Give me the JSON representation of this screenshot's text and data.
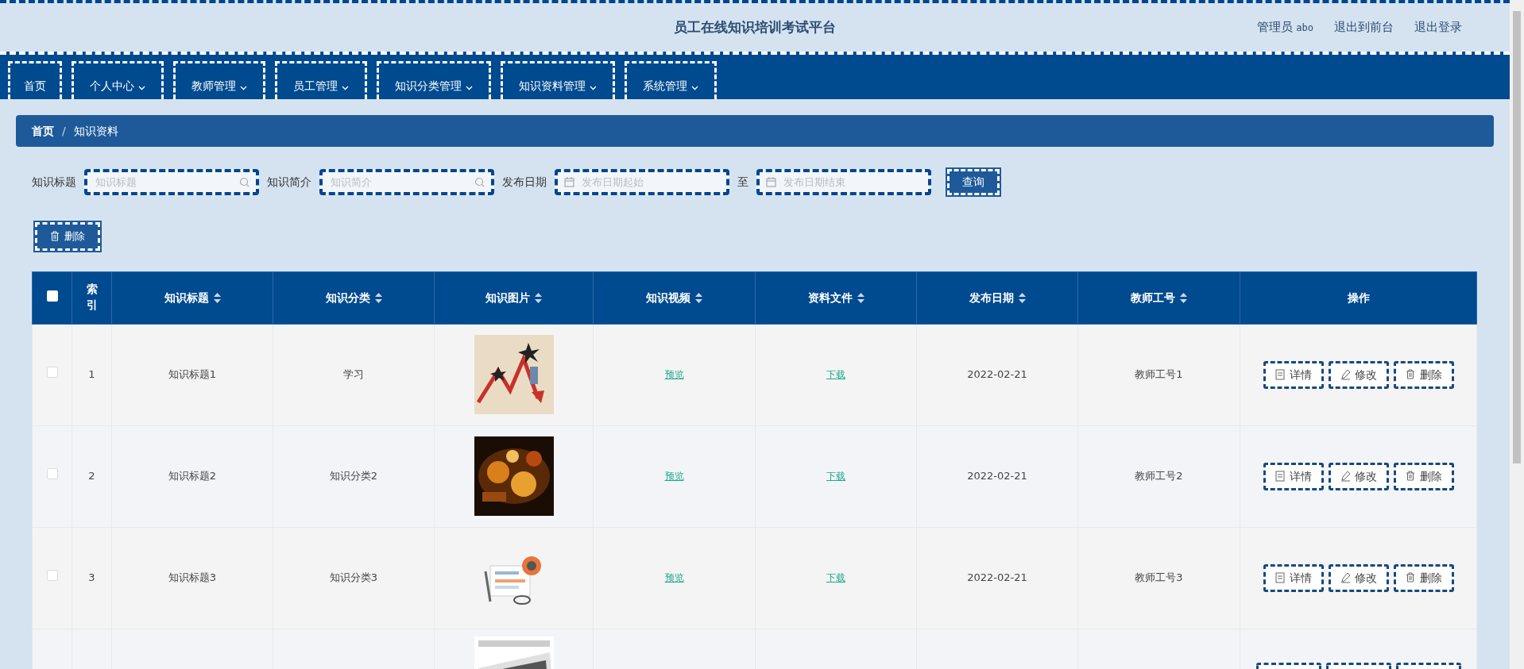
{
  "header": {
    "title": "员工在线知识培训考试平台",
    "user_role": "管理员",
    "user_name": "abo",
    "links": [
      "退出到前台",
      "退出登录"
    ]
  },
  "nav": [
    {
      "label": "首页",
      "dropdown": false
    },
    {
      "label": "个人中心",
      "dropdown": true
    },
    {
      "label": "教师管理",
      "dropdown": true
    },
    {
      "label": "员工管理",
      "dropdown": true
    },
    {
      "label": "知识分类管理",
      "dropdown": true
    },
    {
      "label": "知识资料管理",
      "dropdown": true
    },
    {
      "label": "系统管理",
      "dropdown": true
    }
  ],
  "breadcrumb": {
    "items": [
      "首页",
      "知识资料"
    ],
    "separator": "/"
  },
  "filters": [
    {
      "label": "知识标题",
      "placeholder": "知识标题",
      "kind": "search"
    },
    {
      "label": "知识简介",
      "placeholder": "知识简介",
      "kind": "search"
    },
    {
      "label": "发布日期",
      "placeholder": "发布日期起始",
      "kind": "date"
    },
    {
      "label": "至",
      "placeholder": "发布日期结束",
      "kind": "date"
    }
  ],
  "search_button": "查询",
  "delete_button": "删除",
  "table": {
    "select_all_checked": false,
    "columns": [
      {
        "label": "索引",
        "sortable": false
      },
      {
        "label": "知识标题",
        "sortable": true
      },
      {
        "label": "知识分类",
        "sortable": true
      },
      {
        "label": "知识图片",
        "sortable": true
      },
      {
        "label": "知识视频",
        "sortable": true
      },
      {
        "label": "资料文件",
        "sortable": true
      },
      {
        "label": "发布日期",
        "sortable": true
      },
      {
        "label": "教师工号",
        "sortable": true
      },
      {
        "label": "操作",
        "sortable": false
      }
    ],
    "rows": [
      {
        "index": "1",
        "title": "知识标题1",
        "category": "学习",
        "video": "预览",
        "file": "下载",
        "date": "2022-02-21",
        "teacher": "教师工号1",
        "checked": false,
        "actions": [
          "详情",
          "修改",
          "删除"
        ]
      },
      {
        "index": "2",
        "title": "知识标题2",
        "category": "知识分类2",
        "video": "预览",
        "file": "下载",
        "date": "2022-02-21",
        "teacher": "教师工号2",
        "checked": false,
        "actions": [
          "详情",
          "修改",
          "删除"
        ]
      },
      {
        "index": "3",
        "title": "知识标题3",
        "category": "知识分类3",
        "video": "预览",
        "file": "下载",
        "date": "2022-02-21",
        "teacher": "教师工号3",
        "checked": false,
        "actions": [
          "详情",
          "修改",
          "删除"
        ]
      }
    ],
    "cut_off_row": true
  }
}
